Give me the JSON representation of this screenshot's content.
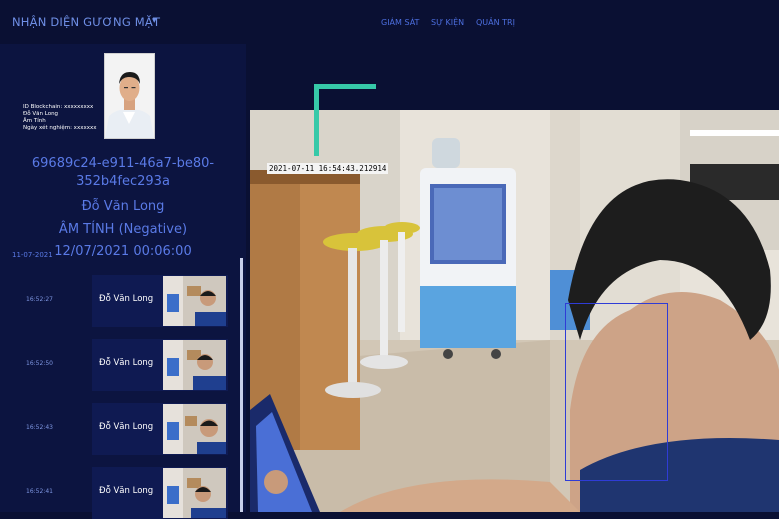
{
  "app": {
    "title": "NHẬN DIỆN GƯƠNG MẶT",
    "menu_caret": "▾"
  },
  "nav": [
    {
      "label": "GIÁM SÁT"
    },
    {
      "label": "SỰ KIỆN"
    },
    {
      "label": "QUẢN TRỊ"
    }
  ],
  "profile": {
    "id_line": "ID Blockchain: xxxxxxxxx",
    "name_line": "Đỗ Văn Long",
    "status_line": "Âm Tính",
    "test_date_line": "Ngày xét nghiệm: xxxxxxx",
    "hash_line1": "69689c24-e911-46a7-be80-",
    "hash_line2": "352b4fec293a",
    "full_name": "Đỗ Văn Long",
    "result": "ÂM TÍNH (Negative)",
    "datetime": "12/07/2021 00:06:00"
  },
  "history_date": "11-07-2021",
  "history": [
    {
      "time": "16:52:27",
      "name": "Đỗ Văn Long"
    },
    {
      "time": "16:52:50",
      "name": "Đỗ Văn Long"
    },
    {
      "time": "16:52:43",
      "name": "Đỗ Văn Long"
    },
    {
      "time": "16:52:41",
      "name": "Đỗ Văn Long"
    }
  ],
  "camera": {
    "timestamp": "2021-07-11 16:54:43.212914"
  },
  "colors": {
    "accent": "#36c9a8",
    "face_box": "#2f3cd6",
    "panel": "#0c1440",
    "title": "#5a7ae6"
  }
}
